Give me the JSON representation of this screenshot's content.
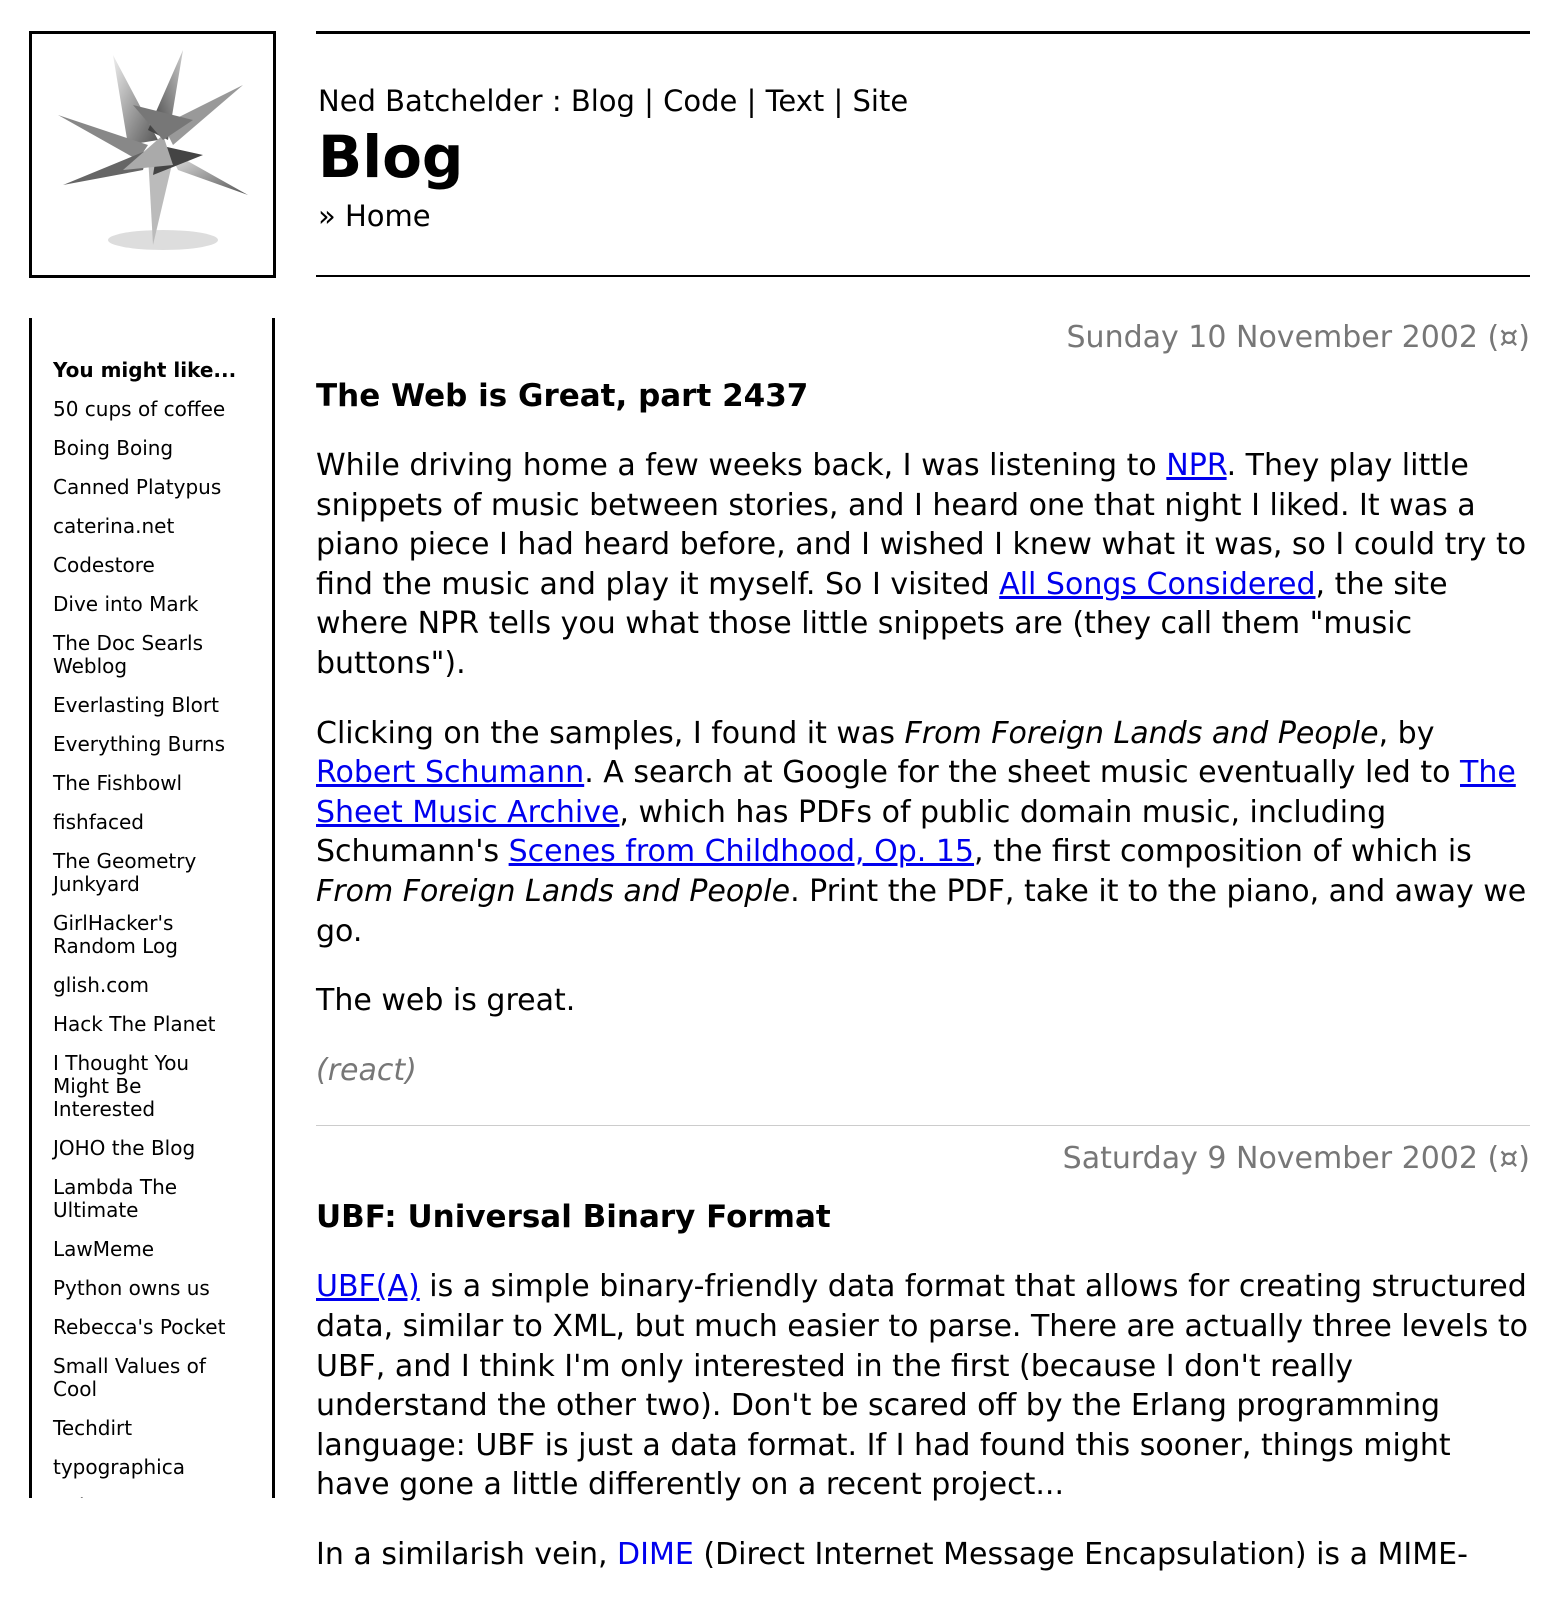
{
  "header": {
    "nav": {
      "owner": "Ned Batchelder",
      "sep_colon": " : ",
      "blog": "Blog",
      "code": "Code",
      "text": "Text",
      "site": "Site",
      "pipe": " | "
    },
    "title": "Blog",
    "breadcrumb": "» Home"
  },
  "sidebar": {
    "heading": "You might like...",
    "items": [
      "50 cups of coffee",
      "Boing Boing",
      "Canned Platypus",
      "caterina.net",
      "Codestore",
      "Dive into Mark",
      "The Doc Searls Weblog",
      "Everlasting Blort",
      "Everything Burns",
      "The Fishbowl",
      "fishfaced",
      "The Geometry Junkyard",
      "GirlHacker's Random Log",
      "glish.com",
      "Hack The Planet",
      "I Thought You Might Be Interested",
      "JOHO the Blog",
      "Lambda The Ultimate",
      "LawMeme",
      "Python owns us",
      "Rebecca's Pocket",
      "Small Values of Cool",
      "Techdirt",
      "typographica",
      "eBlogger"
    ]
  },
  "posts": [
    {
      "date": "Sunday 10 November 2002 (¤)",
      "title": "The Web is Great, part 2437",
      "p1": {
        "a": "While driving home a few weeks back, I was listening to ",
        "link1": "NPR",
        "b": ". They play little snippets of music between stories, and I heard one that night I liked. It was a piano piece I had heard before, and I wished I knew what it was, so I could try to find the music and play it myself. So I visited ",
        "link2": "All Songs Considered",
        "c": ", the site where NPR tells you what those little snippets are (they call them \"music buttons\")."
      },
      "p2": {
        "a": "Clicking on the samples, I found it was ",
        "em1": "From Foreign Lands and People",
        "b": ", by ",
        "link1": "Robert Schumann",
        "c": ". A search at Google for the sheet music eventually led to ",
        "link2": "The Sheet Music Archive",
        "d": ", which has PDFs of public domain music, including Schumann's ",
        "link3": "Scenes from Childhood, Op. 15",
        "e": ", the first composition of which is ",
        "em2": "From Foreign Lands and People",
        "f": ". Print the PDF, take it to the piano, and away we go."
      },
      "p3": "The web is great.",
      "react": "(react)"
    },
    {
      "date": "Saturday 9 November 2002 (¤)",
      "title": "UBF: Universal Binary Format",
      "p1": {
        "link1": "UBF(A)",
        "a": " is a simple binary-friendly data format that allows for creating structured data, similar to XML, but much easier to parse. There are actually three levels to UBF, and I think I'm only interested in the first (because I don't really understand the other two). Don't be scared off by the Erlang programming language: UBF is just a data format. If I had found this sooner, things might have gone a little differently on a recent project..."
      },
      "p2": {
        "a": "In a similarish vein, ",
        "link1": "DIME",
        "b": " (Direct Internet Message Encapsulation) is a MIME-"
      }
    }
  ],
  "colors": {
    "link": "#0000ee",
    "muted": "#777777"
  }
}
